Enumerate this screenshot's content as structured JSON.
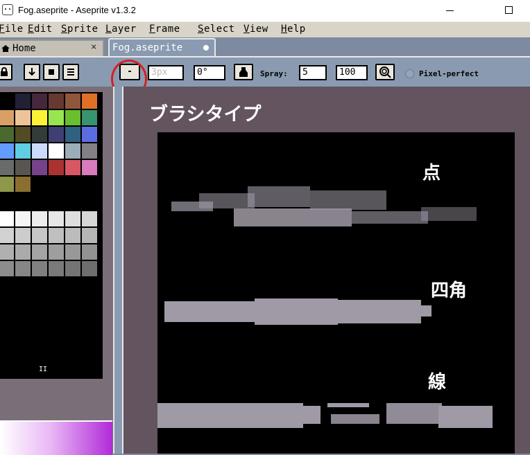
{
  "window": {
    "title": "Fog.aseprite - Aseprite v1.3.2"
  },
  "menu": {
    "items": [
      "File",
      "Edit",
      "Sprite",
      "Layer",
      "Frame",
      "Select",
      "View",
      "Help"
    ]
  },
  "tabs": {
    "home_label": "Home",
    "home_close": "×",
    "file_label": "Fog.aseprite"
  },
  "toolbar": {
    "brush_type_symbol": "-",
    "brush_size": "3px",
    "brush_angle": "0°",
    "spray_label": "Spray:",
    "spray_width": "5",
    "spray_speed": "100",
    "pixel_perfect_label": "Pixel-perfect"
  },
  "palette": {
    "colors": [
      "#000000",
      "#222034",
      "#45283c",
      "#663931",
      "#8f563b",
      "#df7126",
      "#d9a066",
      "#eec39a",
      "#fbf236",
      "#99e550",
      "#6abe30",
      "#37946e",
      "#4b692f",
      "#524b24",
      "#323c39",
      "#3f3f74",
      "#306082",
      "#5b6ee1",
      "#639bff",
      "#5fcde4",
      "#cbdbfc",
      "#ffffff",
      "#9badb7",
      "#847e87",
      "#696a6a",
      "#595652",
      "#76428a",
      "#ac3232",
      "#d95763",
      "#d77bba",
      "#8f974a",
      "#8a6f30",
      "#000000",
      "#000000",
      "#000000",
      "#000000",
      "#000000",
      "#000000",
      "#000000",
      "#000000",
      "#000000",
      "#000000",
      "#ffffff",
      "#f5f5f5",
      "#ececec",
      "#e6e6e6",
      "#dedede",
      "#d6d6d6",
      "#d2d2d2",
      "#cccccc",
      "#c6c6c6",
      "#c0c0c0",
      "#bcbcbc",
      "#b6b6b6",
      "#b0b0b0",
      "#aaaaaa",
      "#a4a4a4",
      "#9e9e9e",
      "#989898",
      "#929292",
      "#8c8c8c",
      "#868686",
      "#808080",
      "#7a7a7a",
      "#747474",
      "#6e6e6e"
    ],
    "slider_marker": "II"
  },
  "canvas": {
    "heading": "ブラシタイプ",
    "stroke_labels": [
      "点",
      "四角",
      "線"
    ]
  },
  "colors": {
    "highlight_circle": "#d42020",
    "stroke_fill": "#a09aa6",
    "canvas_background": "#000000",
    "workspace_background": "#63545f"
  }
}
